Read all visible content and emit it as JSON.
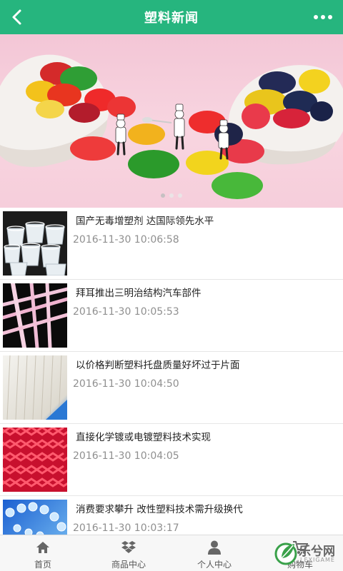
{
  "header": {
    "title": "塑料新闻"
  },
  "banner": {
    "slide_count": 3,
    "active_index": 0
  },
  "news": [
    {
      "title": "国产无毒增塑剂 达国际领先水平",
      "date": "2016-11-30 10:06:58"
    },
    {
      "title": "拜耳推出三明治结构汽车部件",
      "date": "2016-11-30 10:05:53"
    },
    {
      "title": "以价格判断塑料托盘质量好坏过于片面",
      "date": "2016-11-30 10:04:50"
    },
    {
      "title": "直接化学镀或电镀塑料技术实现",
      "date": "2016-11-30 10:04:05"
    },
    {
      "title": "消费要求攀升 改性塑料技术需升级换代",
      "date": "2016-11-30 10:03:17"
    }
  ],
  "bottom_nav": [
    {
      "label": "首页",
      "icon": "home-icon"
    },
    {
      "label": "商品中心",
      "icon": "box-icon"
    },
    {
      "label": "个人中心",
      "icon": "person-icon"
    },
    {
      "label": "购物车",
      "icon": "cart-icon"
    }
  ],
  "watermark": {
    "text": "乐兮网",
    "sub": "LEXIGAME"
  },
  "colors": {
    "primary": "#26b57e",
    "date_text": "#8f8f8f",
    "title_text": "#222222"
  }
}
